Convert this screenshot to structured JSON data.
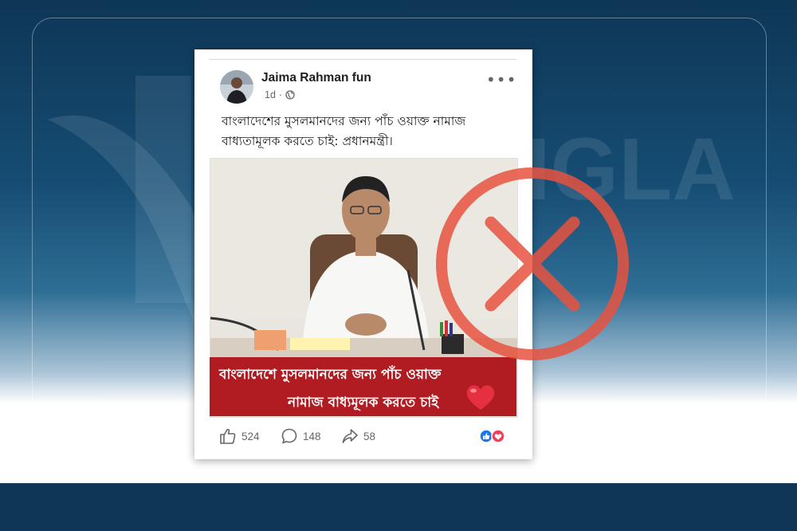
{
  "post": {
    "author": "Jaima Rahman fun",
    "time": "1d",
    "visibility_icon": "globe-icon",
    "more_label": "•••",
    "caption": "বাংলাদেশের মুসলমানদের জন্য পাঁচ ওয়াক্ত নামাজ বাধ্যতামূলক করতে চাই: প্রধানমন্ত্রী।",
    "image_banner": {
      "line1": "বাংলাদেশে মুসলমানদের জন্য পাঁচ ওয়াক্ত",
      "line2": "নামাজ বাধ্যমূলক করতে চাই"
    },
    "likes": "524",
    "comments": "148",
    "shares": "58",
    "reaction_icons": [
      "like-icon",
      "love-icon"
    ]
  },
  "overlay": {
    "verdict_icon": "cross-circle-icon",
    "verdict_color": "#e8523f"
  },
  "colors": {
    "brand_dark": "#0f3557",
    "banner_red": "#b01c22"
  }
}
